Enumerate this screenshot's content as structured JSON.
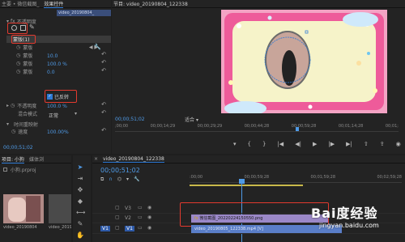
{
  "effect_controls": {
    "tab_source": "主要 • 微信截图_",
    "tab_active": "效果控件",
    "clip_name": "video_20190804_",
    "mask_label": "不透明度",
    "mask_item": "蒙版(1)",
    "mask_path": "蒙版",
    "mask_feather": "蒙版",
    "mask_feather_value": "10.0",
    "mask_opacity": "蒙版",
    "mask_opacity_value": "100.0 %",
    "mask_expand": "蒙版",
    "mask_expand_value": "0.0",
    "inverted_label": "已反转",
    "opacity_label": "不透明度",
    "opacity_value": "100.0 %",
    "blend_label": "混合模式",
    "blend_value": "正常",
    "time_remap_label": "时间重映射",
    "speed_label": "速度",
    "speed_value": "100.00%",
    "timecode": "00;00;51;02"
  },
  "program_monitor": {
    "tab": "节目: video_20190804_122338",
    "timecode": "00;00;51;02",
    "fit_label": "适合",
    "ruler_labels": [
      ";00;00",
      "00;00;14;29",
      "00;00;29;29",
      "00;00;44;28",
      "00;00;59;28",
      "00;01;14;28",
      "00;01;"
    ]
  },
  "project_panel": {
    "tab": "项目: 小狗",
    "media_tab": "媒体浏",
    "project_name": "小狗.prproj",
    "thumb1_label": "video_20190804",
    "thumb2_label": "video_20190"
  },
  "timeline": {
    "tab": "video_20190804_122338",
    "timecode": "00;00;51;02",
    "ruler_labels": [
      ":00;00",
      "00;00;59;28",
      "00;01;59;28",
      "00;02;59;28"
    ],
    "tracks": [
      "V3",
      "V2",
      "V1"
    ],
    "clip_v2": "微信截图_20220224150550.png",
    "clip_v1": "video_20190805_122338.mp4 [V]"
  },
  "watermark": {
    "brand": "Bai度经验",
    "url": "jingyan.baidu.com"
  },
  "colors": {
    "accent": "#2e7bd6",
    "highlight": "#e23a2f",
    "clip_purple": "#9b88c8",
    "clip_blue": "#5a7ec8"
  }
}
